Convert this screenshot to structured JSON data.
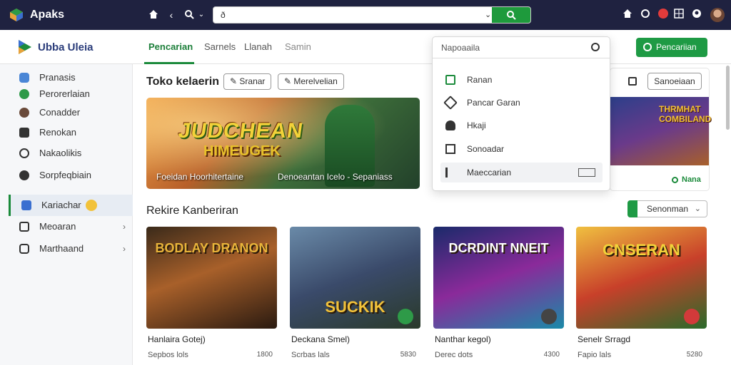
{
  "browser": {
    "app_title": "Apaks",
    "address_text": "ð"
  },
  "header": {
    "brand": "Ubba Uleia",
    "tabs": [
      {
        "label": "Pencarian",
        "active": true
      },
      {
        "label": "Sarnels",
        "active": false
      },
      {
        "label": "Llanah",
        "active": false
      },
      {
        "label": "Samin",
        "active": false
      }
    ],
    "cta_label": "Pencariian"
  },
  "sidebar": {
    "items": [
      {
        "label": "Pranasis",
        "icon": "puzzle-icon",
        "icon_color": "#4a86d6"
      },
      {
        "label": "Perorerlaian",
        "icon": "clover-icon",
        "icon_color": "#2e9a48"
      },
      {
        "label": "Conadder",
        "icon": "profile-icon",
        "icon_color": "#6a4a3a"
      },
      {
        "label": "Renokan",
        "icon": "card-icon",
        "icon_color": "#333333"
      },
      {
        "label": "Nakaolikis",
        "icon": "clock-icon",
        "icon_color": "#333333"
      },
      {
        "label": "Sorpfeqbiain",
        "icon": "globe-icon",
        "icon_color": "#333333"
      },
      {
        "label": "Kariachar",
        "icon": "bookmark-icon",
        "icon_color": "#3a6fd0",
        "active": true
      },
      {
        "label": "Meoaran",
        "icon": "calendar-icon",
        "icon_color": "#333333"
      },
      {
        "label": "Marthaand",
        "icon": "cart-icon",
        "icon_color": "#333333"
      }
    ]
  },
  "featured": {
    "title": "Toko kelaerin",
    "chips": [
      "Sranar",
      "Merelvelian"
    ],
    "hero": {
      "art_title_1": "JUDCHEAN",
      "art_title_2": "HIMEUGEK",
      "caption_left": "Foeidan Hoorhitertaine",
      "caption_right": "Denoeantan Icelo - Sepaniass"
    },
    "side_card": {
      "button": "Sanoeiaan",
      "art_title": "THRMHAT COMBILAND",
      "tag": "Nana"
    }
  },
  "dropdown": {
    "placeholder": "Napoaaila",
    "items": [
      {
        "label": "Ranan",
        "icon": "window-icon",
        "icon_color": "#1c8b3c"
      },
      {
        "label": "Pancar Garan",
        "icon": "tag-icon",
        "icon_color": "#333333"
      },
      {
        "label": "Hkaji",
        "icon": "user-icon",
        "icon_color": "#333333"
      },
      {
        "label": "Sonoadar",
        "icon": "grid-icon",
        "icon_color": "#333333"
      },
      {
        "label": "Maeccarian",
        "icon": "play-icon",
        "icon_color": "#333333",
        "hover": true
      }
    ]
  },
  "recommendations": {
    "title": "Rekire Kanberiran",
    "sort_label": "Senonman",
    "games": [
      {
        "name": "Hanlaira Gotej)",
        "meta": "Sepbos lols",
        "size": "1800",
        "art_title": "BODLAY DRANON",
        "bg": "linear-gradient(160deg,#3a2a1a 0%,#a8602a 45%,#2a1a10 100%)",
        "art_color": "#e8b43a"
      },
      {
        "name": "Deckana Smel)",
        "meta": "Scrbas lals",
        "size": "5830",
        "art_title": "SUCKIK",
        "bg": "linear-gradient(160deg,#6a8aa8 0%,#3a4a6a 50%,#2a3a2a 100%)",
        "art_color": "#f2c23a",
        "badge": "#2e9a48"
      },
      {
        "name": "Nanthar kegol)",
        "meta": "Derec dots",
        "size": "4300",
        "art_title": "DCRDINT NNEIT",
        "bg": "linear-gradient(160deg,#1a2a6a 0%,#8a2a9a 50%,#1a8aa8 100%)",
        "art_color": "#ffffff",
        "badge": "#444444"
      },
      {
        "name": "Senelr Srragd",
        "meta": "Fapio lals",
        "size": "5280",
        "art_title": "CNSERAN",
        "bg": "linear-gradient(160deg,#f0c040 0%,#c8402a 50%,#2a6a2a 100%)",
        "art_color": "#f2d23a",
        "badge": "#d23a3a"
      }
    ]
  }
}
